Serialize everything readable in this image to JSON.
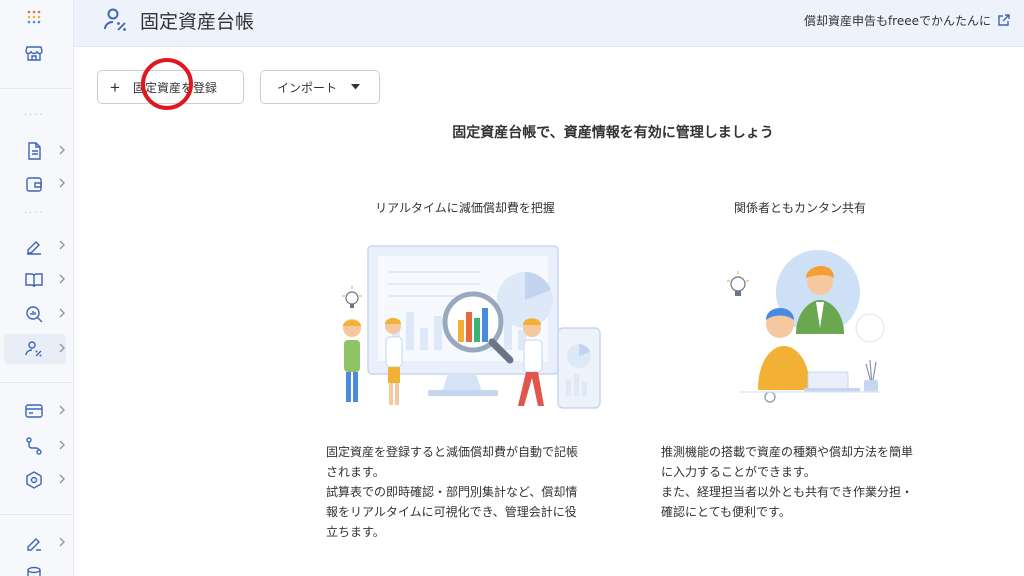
{
  "header": {
    "title": "固定資産台帳",
    "promo_link": "償却資産申告もfreeeでかんたんに"
  },
  "toolbar": {
    "register_label": "固定資産を登録",
    "import_label": "インポート"
  },
  "main": {
    "heading": "固定資産台帳で、資産情報を有効に管理しましょう",
    "features": [
      {
        "title": "リアルタイムに減価償却費を把握",
        "description": "固定資産を登録すると減価償却費が自動で記帳\nされます。\n試算表での即時確認・部門別集計など、償却情\n報をリアルタイムに可視化でき、管理会計に役\n立ちます。"
      },
      {
        "title": "関係者ともカンタン共有",
        "description": "推測機能の搭載で資産の種類や償却方法を簡単\nに入力することができます。\nまた、経理担当者以外とも共有でき作業分担・\n確認にとても便利です。"
      }
    ]
  },
  "sidebar": {
    "items": [
      {
        "icon": "apps-grid-icon"
      },
      {
        "icon": "store-icon"
      },
      {
        "icon": "document-icon"
      },
      {
        "icon": "wallet-icon"
      },
      {
        "icon": "pen-icon"
      },
      {
        "icon": "book-icon"
      },
      {
        "icon": "analytics-search-icon"
      },
      {
        "icon": "asset-user-icon",
        "active": true
      },
      {
        "icon": "card-icon"
      },
      {
        "icon": "workflow-icon"
      },
      {
        "icon": "settings-hex-icon"
      },
      {
        "icon": "pen-icon-2"
      },
      {
        "icon": "database-icon"
      }
    ]
  },
  "colors": {
    "accent": "#3f64b9",
    "header_bg": "#eef3fb",
    "sidebar_bg": "#f6f8fb",
    "annotation_red": "#e0171e"
  }
}
